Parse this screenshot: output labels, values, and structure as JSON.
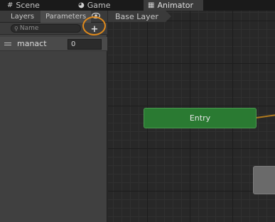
{
  "window_tabs": [
    {
      "label": "Scene",
      "icon": "grid-icon"
    },
    {
      "label": "Game",
      "icon": "pacman-icon"
    },
    {
      "label": "Animator",
      "icon": "animator-icon"
    }
  ],
  "left_panel": {
    "tabs": [
      "Layers",
      "Parameters"
    ],
    "search_placeholder": "Name",
    "add_button_label": "+",
    "parameters": [
      {
        "name": "manact",
        "value": "0"
      }
    ]
  },
  "graph": {
    "breadcrumb": "Base Layer",
    "entry_node_label": "Entry"
  },
  "colors": {
    "highlight_ring": "#e08a1c",
    "entry_node": "#2a7a32",
    "transition": "#b07a1e"
  }
}
